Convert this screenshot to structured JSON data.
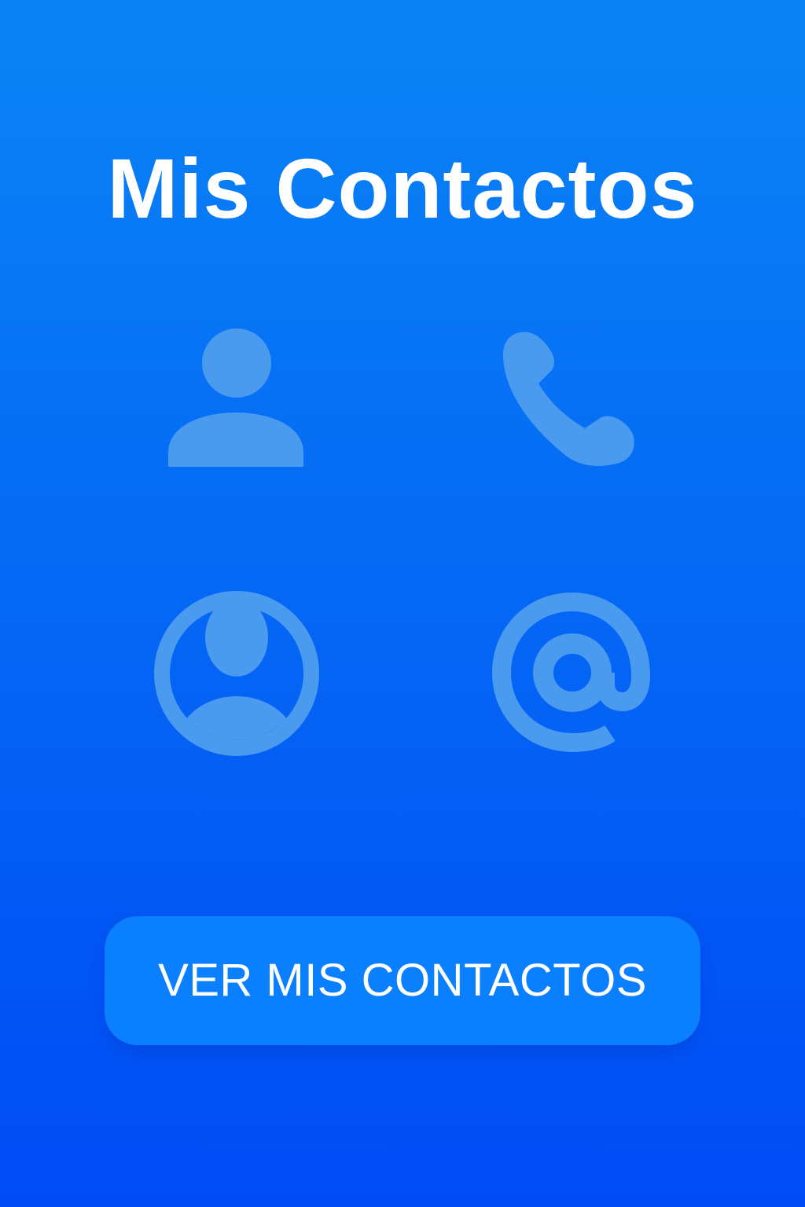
{
  "colors": {
    "background_top": "#0A84F5",
    "background_bottom": "#004BF5",
    "icon_fill": "#4A9AF0",
    "button_background": "#0A80FF",
    "text": "#FFFFFF"
  },
  "header": {
    "title": "Mis Contactos"
  },
  "icons": [
    {
      "name": "person-icon"
    },
    {
      "name": "phone-icon"
    },
    {
      "name": "account-circle-icon"
    },
    {
      "name": "at-sign-icon"
    }
  ],
  "primary_action": {
    "label": "VER MIS CONTACTOS"
  }
}
